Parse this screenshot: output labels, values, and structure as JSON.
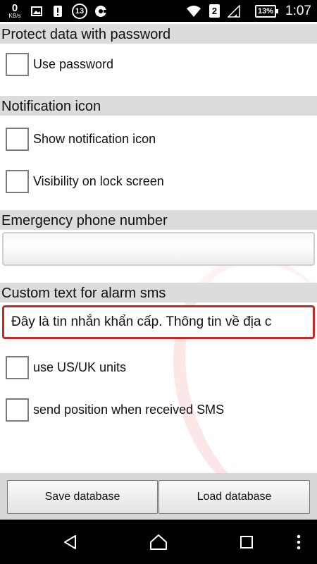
{
  "status_bar": {
    "speed_value": "0",
    "speed_unit": "KB/s",
    "notification_count": "13",
    "sim_slot": "2",
    "battery": "13%",
    "time": "1:07"
  },
  "sections": {
    "password": {
      "header": "Protect data with password",
      "use_password_label": "Use password"
    },
    "notification": {
      "header": "Notification icon",
      "show_icon_label": "Show notification icon",
      "lock_screen_label": "Visibility on lock screen"
    },
    "emergency": {
      "header": "Emergency phone number",
      "phone_value": ""
    },
    "custom_text": {
      "header": "Custom text for alarm sms",
      "sms_value": "Đây là tin nhắn khẩn cấp. Thông tin về địa c"
    }
  },
  "options": {
    "units_label": "use US/UK units",
    "send_position_label": "send position when received SMS"
  },
  "buttons": {
    "save_label": "Save database",
    "load_label": "Load database"
  },
  "nav_icons": [
    "back-icon",
    "home-icon",
    "recents-icon",
    "overflow-menu-icon"
  ],
  "colors": {
    "section_header_bg": "#dcdcdc",
    "focused_input_border": "#c62828",
    "button_bar_bg": "#d7d7d7"
  }
}
